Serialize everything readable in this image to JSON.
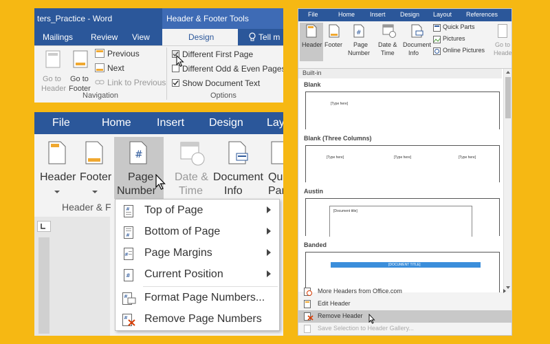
{
  "panel1": {
    "title": "ters_Practice - Word",
    "tools_title": "Header & Footer Tools",
    "tabs": [
      "Mailings",
      "Review",
      "View"
    ],
    "active_tab": "Design",
    "tell_me": "Tell m",
    "goto_header": [
      "Go to",
      "Header"
    ],
    "goto_footer": [
      "Go to",
      "Footer"
    ],
    "previous": "Previous",
    "next": "Next",
    "link_to_previous": "Link to Previous",
    "group_navigation": "Navigation",
    "different_first_page": "Different First Page",
    "different_odd_even": "Different Odd & Even Pages",
    "show_document_text": "Show Document Text",
    "group_options": "Options"
  },
  "panel2": {
    "tabs": [
      "File",
      "Home",
      "Insert",
      "Design",
      "Lay"
    ],
    "header_label": "Header",
    "footer_label": "Footer",
    "page_number_label": [
      "Page",
      "Number"
    ],
    "date_time_label": [
      "Date &",
      "Time"
    ],
    "document_info_label": [
      "Document",
      "Info"
    ],
    "qu_label": [
      "Qu",
      "Par"
    ],
    "group_label": "Header & F",
    "menu_items": [
      {
        "label": "Top of Page",
        "submenu": true
      },
      {
        "label": "Bottom of Page",
        "submenu": true
      },
      {
        "label": "Page Margins",
        "submenu": true
      },
      {
        "label": "Current Position",
        "submenu": true
      },
      {
        "label": "Format Page Numbers...",
        "submenu": false
      },
      {
        "label": "Remove Page Numbers",
        "submenu": false
      }
    ]
  },
  "panel3": {
    "tabs": [
      "File",
      "Home",
      "Insert",
      "Design",
      "Layout",
      "References"
    ],
    "header_label": "Header",
    "footer_label": "Footer",
    "page_number_label": [
      "Page",
      "Number"
    ],
    "date_time_label": [
      "Date &",
      "Time"
    ],
    "document_info_label": [
      "Document",
      "Info"
    ],
    "quick_parts": "Quick Parts",
    "pictures": "Pictures",
    "online_pictures": "Online Pictures",
    "goto_label": [
      "Go to",
      "Header"
    ],
    "built_in": "Built-in",
    "sections": [
      "Blank",
      "Blank (Three Columns)",
      "Austin",
      "Banded"
    ],
    "placeholder": "[Type here]",
    "austin_placeholder": "[Document title]",
    "banded_placeholder": "[DOCUMENT TITLE]",
    "bottom_items": [
      "More Headers from Office.com",
      "Edit Header",
      "Remove Header",
      "Save Selection to Header Gallery..."
    ]
  },
  "colors": {
    "background": "#F6B813",
    "word_blue": "#2B579A",
    "tools_blue": "#3E6BB5",
    "banded_blue": "#3B8EDB",
    "highlight": "#C8C8C8"
  }
}
